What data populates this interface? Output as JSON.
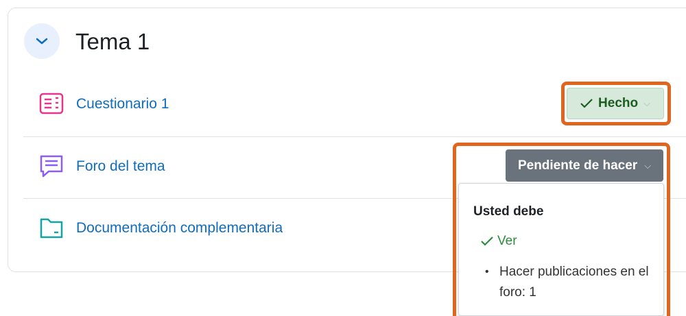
{
  "section": {
    "title": "Tema 1",
    "accent_color": "#0f6cbf"
  },
  "activities": [
    {
      "name": "Cuestionario 1",
      "icon": "quiz-icon",
      "icon_color": "#e8348e"
    },
    {
      "name": "Foro del tema",
      "icon": "forum-icon",
      "icon_color": "#8b5cf6"
    },
    {
      "name": "Documentación complementaria",
      "icon": "folder-icon",
      "icon_color": "#14a3a3"
    }
  ],
  "completion": {
    "done_label": "Hecho",
    "todo_label": "Pendiente de hacer",
    "done_bg": "#d7e9db",
    "todo_bg": "#6a737b",
    "highlight_color": "#e0651f"
  },
  "popover": {
    "title": "Usted debe",
    "done_item": "Ver",
    "pending_item": "Hacer publicaciones en el foro: 1"
  }
}
